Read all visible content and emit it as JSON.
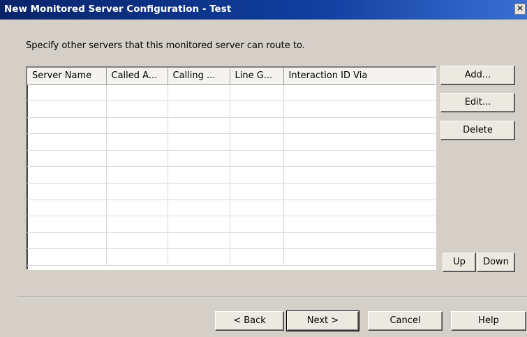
{
  "window": {
    "title": "New Monitored Server Configuration - Test",
    "close_glyph": "✕"
  },
  "instruction": "Specify other servers that this monitored server can route to.",
  "table": {
    "columns": [
      "Server Name",
      "Called A...",
      "Calling ...",
      "Line G...",
      "Interaction ID Via"
    ],
    "rows": []
  },
  "side_buttons": {
    "add": "Add...",
    "edit": "Edit...",
    "delete": "Delete",
    "up": "Up",
    "down": "Down"
  },
  "footer_buttons": {
    "back": "< Back",
    "next": "Next >",
    "cancel": "Cancel",
    "help": "Help"
  }
}
